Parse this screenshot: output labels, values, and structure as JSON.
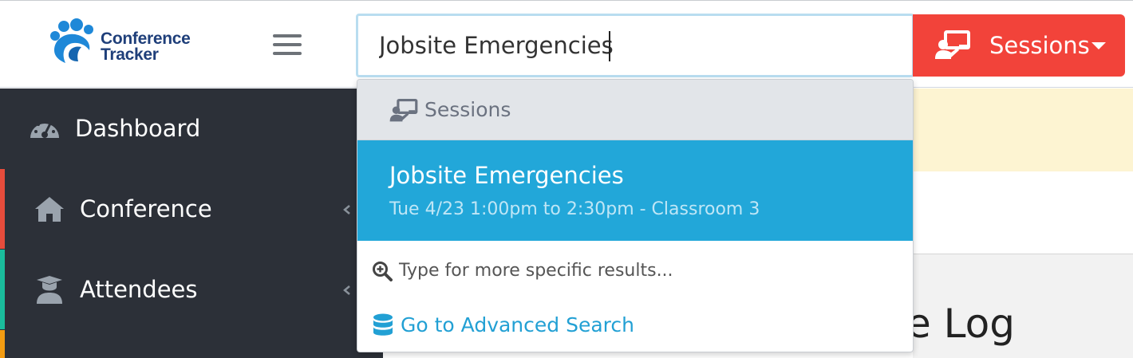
{
  "app": {
    "logo_line1": "Conference",
    "logo_line2": "Tracker"
  },
  "header": {
    "search_value": "Jobsite Emergencies",
    "sessions_button_label": "Sessions"
  },
  "sidebar": {
    "items": [
      {
        "label": "Dashboard",
        "icon": "dashboard-gauge-icon"
      },
      {
        "label": "Conference",
        "icon": "home-icon",
        "accent": "#e74c3c"
      },
      {
        "label": "Attendees",
        "icon": "graduate-icon",
        "accent": "#1abc9c"
      }
    ]
  },
  "dropdown": {
    "section_label": "Sessions",
    "results": [
      {
        "title": "Jobsite Emergencies",
        "detail": "Tue 4/23 1:00pm to 2:30pm - Classroom 3"
      }
    ],
    "hint": "Type for more specific results...",
    "advanced_link": "Go to Advanced Search"
  },
  "main": {
    "title_partial": "e Log"
  },
  "colors": {
    "brand_blue": "#1f3f7a",
    "sessions_button": "#f2433a",
    "highlight_result": "#22a7d9",
    "sidebar_bg": "#2c3038",
    "alert_bg": "#fdf4d2",
    "link": "#22a0d4"
  }
}
